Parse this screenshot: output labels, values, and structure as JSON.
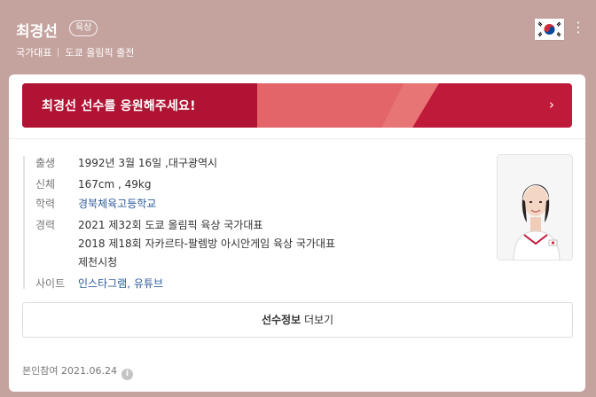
{
  "profile": {
    "name": "최경선",
    "sport": "육상",
    "team": "국가대표",
    "event": "도쿄 올림픽 출전"
  },
  "cheer": {
    "text": "최경선 선수를 응원해주세요!",
    "arrow": "›"
  },
  "details": {
    "birth": {
      "label": "출생",
      "value": "1992년 3월 16일 ,대구광역시"
    },
    "body": {
      "label": "신체",
      "value": "167cm , 49kg"
    },
    "school": {
      "label": "학력",
      "value": "경북체육고등학교"
    },
    "career": {
      "label": "경력",
      "items": [
        "2021 제32회 도쿄 올림픽 육상 국가대표",
        "2018 제18회 자카르타-팔렘방 아시안게임 육상 국가대표",
        "제천시청"
      ]
    },
    "site": {
      "label": "사이트",
      "links": [
        "인스타그램",
        "유튜브"
      ],
      "sep": ","
    }
  },
  "more_button": {
    "bold": "선수정보",
    "rest": "더보기"
  },
  "footer": {
    "text": "본인참여 2021.06.24",
    "info_icon": "i"
  },
  "colors": {
    "header_bg": "#c4a29d",
    "cheer_bg": "#c01a3a",
    "link": "#2d5b9a"
  },
  "icons": {
    "flag": "korea-flag-icon",
    "more": "more-vertical-icon",
    "arrow": "chevron-right-icon"
  }
}
